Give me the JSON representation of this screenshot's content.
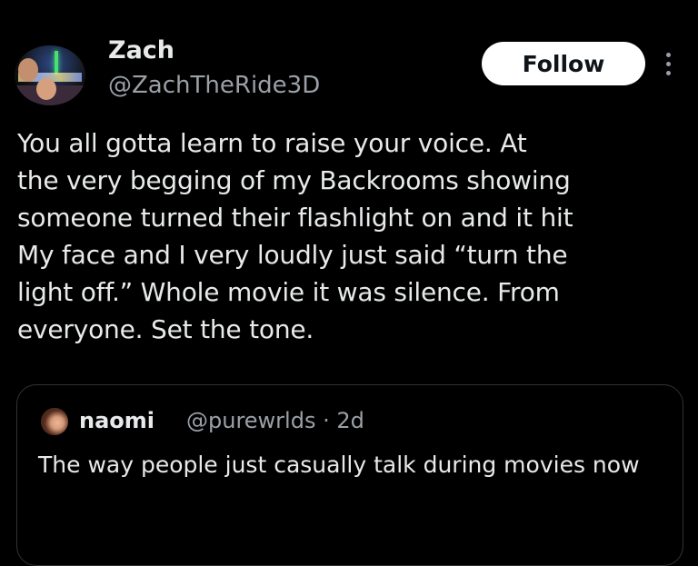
{
  "author": {
    "name": "Zach",
    "handle": "@ZachTheRide3D",
    "avatar_icon": "profile-photo"
  },
  "actions": {
    "follow_label": "Follow",
    "more_icon": "more-vertical-icon"
  },
  "tweet": {
    "text": "You all gotta learn to raise your voice. At\nthe very begging of my Backrooms showing\nsomeone turned their flashlight on and it hit\nMy face and I very loudly just said “turn the\nlight off.” Whole movie it was silence. From\neveryone. Set the tone."
  },
  "quoted": {
    "name": "naomi",
    "meta": "@purewrlds · 2d",
    "text": "The way people just casually talk during movies now"
  },
  "colors": {
    "background": "#000000",
    "primary_text": "#e7e9ea",
    "secondary_text": "#9aa0a6",
    "follow_bg": "#ffffff",
    "quote_border": "#2f3336"
  }
}
